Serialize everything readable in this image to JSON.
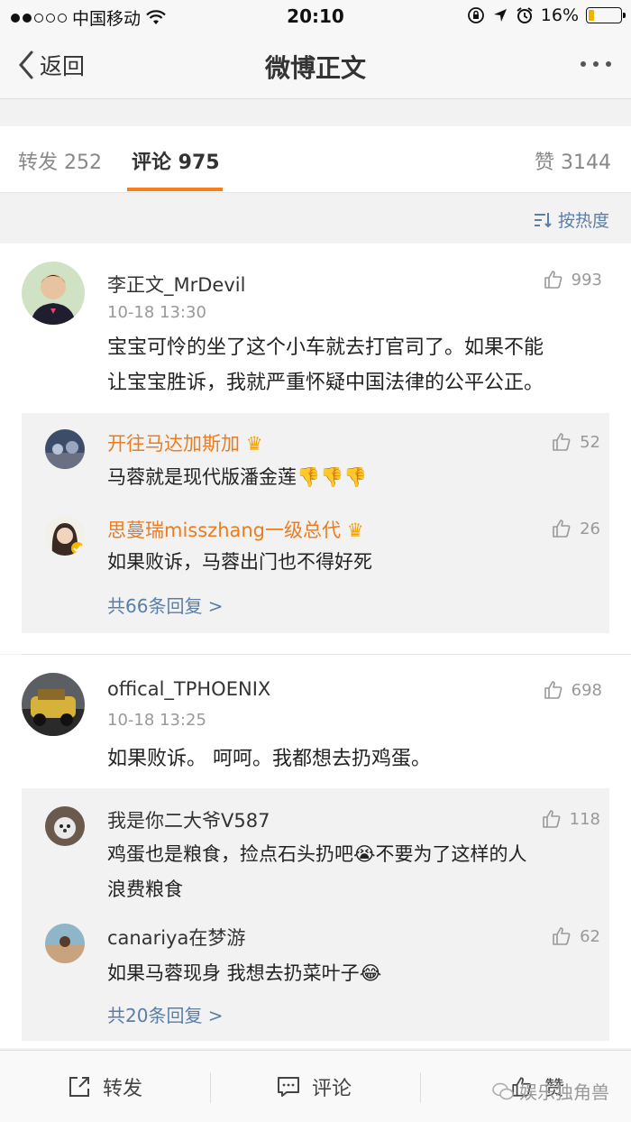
{
  "status_bar": {
    "signal_dots": "●●○○○",
    "carrier": "中国移动",
    "time": "20:10",
    "battery": "16%"
  },
  "nav": {
    "back_label": "返回",
    "title": "微博正文"
  },
  "tabs": [
    {
      "label": "转发 252"
    },
    {
      "label": "评论 975"
    },
    {
      "label": "赞 3144"
    }
  ],
  "sort_label": "按热度",
  "comments": [
    {
      "user": "李正文_MrDevil",
      "time": "10-18 13:30",
      "likes": "993",
      "text_lines": [
        "宝宝可怜的坐了这个小车就去打官司了。如果不能",
        "让宝宝胜诉，我就严重怀疑中国法律的公平公正。"
      ],
      "replies": [
        {
          "user": "开往马达加斯加",
          "likes": "52",
          "text": "马蓉就是现代版潘金莲",
          "emoji": "👎👎👎"
        },
        {
          "user": "思蔓瑞misszhang一级总代",
          "likes": "26",
          "text": "如果败诉，马蓉出门也不得好死"
        }
      ],
      "more_replies": "共66条回复 >"
    },
    {
      "user": "offical_TPHOENIX",
      "time": "10-18 13:25",
      "likes": "698",
      "text_lines": [
        "如果败诉。 呵呵。我都想去扔鸡蛋。"
      ],
      "replies": [
        {
          "user": "我是你二大爷V587",
          "likes": "118",
          "text_line1": "鸡蛋也是粮食，捡点石头扔吧",
          "emoji1": "😭",
          "text_line1b": "不要为了这样的人",
          "text_line2": "浪费粮食"
        },
        {
          "user": "canariya在梦游",
          "likes": "62",
          "text": "如果马蓉现身 我想去扔菜叶子",
          "emoji": "😂"
        }
      ],
      "more_replies": "共20条回复 >"
    }
  ],
  "toolbar": {
    "repost": "转发",
    "comment": "评论",
    "like": "赞"
  },
  "watermark": "娱乐独角兽",
  "colors": {
    "accent": "#fb7c1b",
    "link": "#5a7ea6",
    "vip_name": "#eb7c1f"
  }
}
